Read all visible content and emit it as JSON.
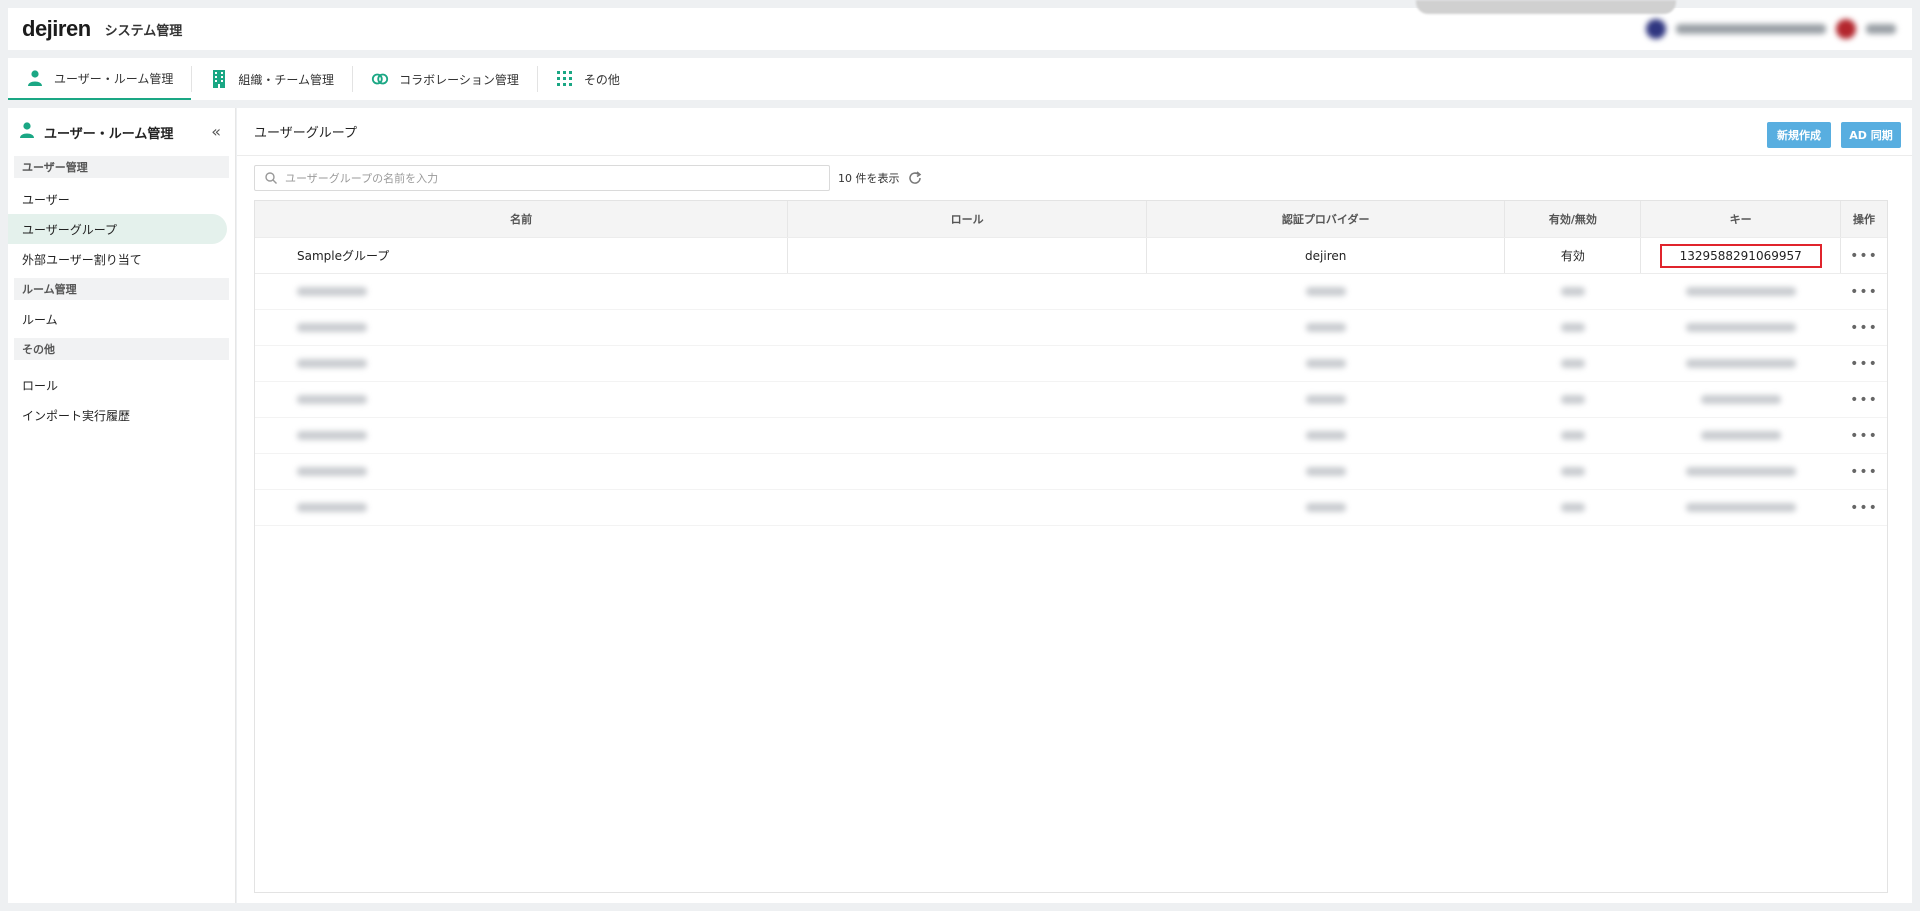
{
  "header": {
    "logo": "dejiren",
    "app_title": "システム管理"
  },
  "tabs": [
    {
      "label": "ユーザー・ルーム管理",
      "icon": "person-icon"
    },
    {
      "label": "組織・チーム管理",
      "icon": "building-icon"
    },
    {
      "label": "コラボレーション管理",
      "icon": "link-icon"
    },
    {
      "label": "その他",
      "icon": "grid-icon"
    }
  ],
  "sidebar": {
    "title": "ユーザー・ルーム管理",
    "sections": [
      {
        "label": "ユーザー管理"
      },
      {
        "label": "ルーム管理"
      },
      {
        "label": "その他"
      }
    ],
    "items": [
      {
        "label": "ユーザー"
      },
      {
        "label": "ユーザーグループ"
      },
      {
        "label": "外部ユーザー割り当て"
      },
      {
        "label": "ルーム"
      },
      {
        "label": "ロール"
      },
      {
        "label": "インポート実行履歴"
      }
    ]
  },
  "main": {
    "title": "ユーザーグループ",
    "buttons": {
      "create": "新規作成",
      "ad_sync": "AD 同期"
    },
    "search_placeholder": "ユーザーグループの名前を入力",
    "count_label": "10 件を表示",
    "columns": [
      "名前",
      "ロール",
      "認証プロバイダー",
      "有効/無効",
      "キー",
      "操作"
    ],
    "rows": [
      {
        "name": "Sampleグループ",
        "role": "",
        "provider": "dejiren",
        "enabled": "有効",
        "key": "1329588291069957",
        "op": "•••"
      }
    ],
    "blurred_ops": [
      "•••",
      "•••",
      "•••",
      "•••",
      "•••",
      "•••",
      "•••"
    ]
  },
  "colors": {
    "accent": "#1aa784",
    "button": "#58aee0",
    "highlight": "#e0242c",
    "active_bg": "#e4f1ec"
  }
}
